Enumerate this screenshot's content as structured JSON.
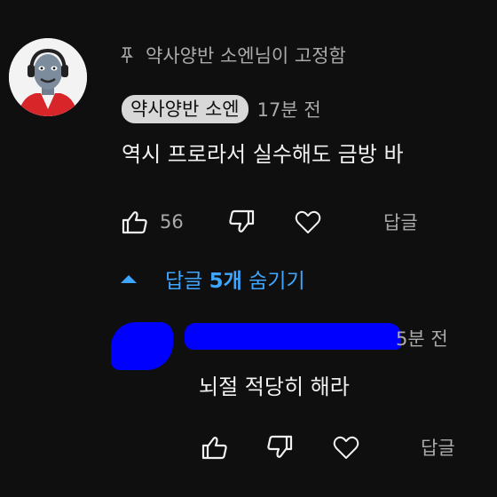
{
  "pinned_comment": {
    "pinned_label": "약사양반 소엔님이 고정함",
    "author": "약사양반 소엔",
    "time": "17분 전",
    "text": "역시 프로라서 실수해도 금방 바",
    "like_count": "56",
    "reply_label": "답글",
    "icons": [
      "pin-icon",
      "thumb-up-icon",
      "thumb-down-icon",
      "heart-icon"
    ]
  },
  "replies_toggle": {
    "label_prefix": "답글 ",
    "label_count": "5개",
    "label_suffix": " 숨기기",
    "icon": "caret-up-icon"
  },
  "reply": {
    "time": "5분 전",
    "text": "뇌절 적당히 해라",
    "reply_label": "답글",
    "redaction_color": "#0000ff"
  },
  "colors": {
    "background": "#0f0f0f",
    "text": "#f1f1f1",
    "secondary": "#aaaaaa",
    "accent": "#3ea6ff",
    "chip": "#d8d8d8"
  }
}
